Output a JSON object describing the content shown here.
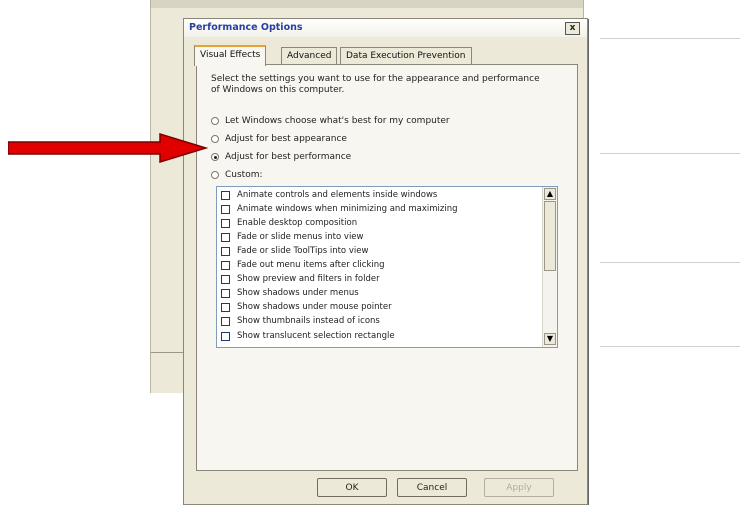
{
  "dialog": {
    "title": "Performance Options",
    "close_label": "x"
  },
  "tabs": [
    {
      "label": "Visual Effects",
      "active": true
    },
    {
      "label": "Advanced",
      "active": false
    },
    {
      "label": "Data Execution Prevention",
      "active": false
    }
  ],
  "description": "Select the settings you want to use for the appearance and performance of Windows on this computer.",
  "radio_options": [
    {
      "label": "Let Windows choose what's best for my computer",
      "checked": false
    },
    {
      "label": "Adjust for best appearance",
      "checked": false
    },
    {
      "label": "Adjust for best performance",
      "checked": true
    },
    {
      "label": "Custom:",
      "checked": false
    }
  ],
  "effects": [
    {
      "label": "Animate controls and elements inside windows",
      "checked": false
    },
    {
      "label": "Animate windows when minimizing and maximizing",
      "checked": false
    },
    {
      "label": "Enable desktop composition",
      "checked": false
    },
    {
      "label": "Fade or slide menus into view",
      "checked": false
    },
    {
      "label": "Fade or slide ToolTips into view",
      "checked": false
    },
    {
      "label": "Fade out menu items after clicking",
      "checked": false
    },
    {
      "label": "Show preview and filters in folder",
      "checked": false
    },
    {
      "label": "Show shadows under menus",
      "checked": false
    },
    {
      "label": "Show shadows under mouse pointer",
      "checked": false
    },
    {
      "label": "Show thumbnails instead of icons",
      "checked": false
    },
    {
      "label": "Show translucent selection rectangle",
      "checked": false
    }
  ],
  "buttons": {
    "ok": "OK",
    "cancel": "Cancel",
    "apply": "Apply"
  },
  "colors": {
    "annotation_arrow": "#e00000",
    "active_tab_accent": "#e5a23a",
    "title_text": "#2a3ea0"
  }
}
